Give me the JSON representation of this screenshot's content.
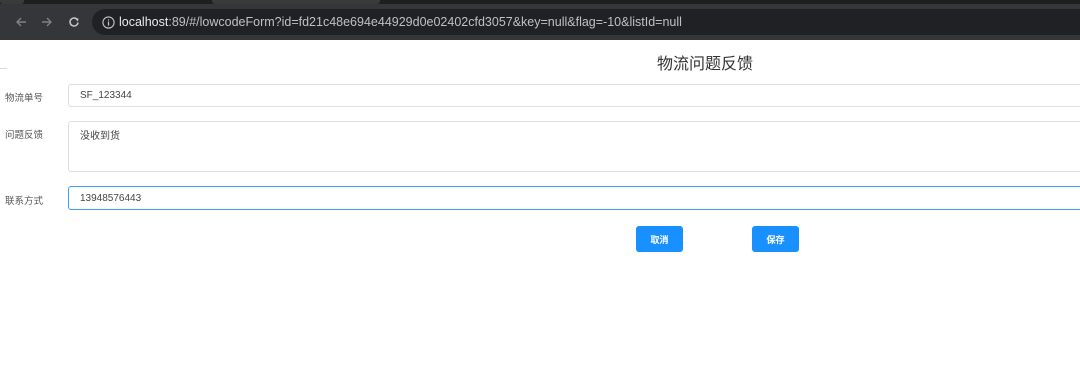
{
  "browser": {
    "url_host": "localhost",
    "url_rest": ":89/#/lowcodeForm?id=fd21c48e694e44929d0e02402cfd3057&key=null&flag=-10&listId=null"
  },
  "form": {
    "title": "物流问题反馈",
    "fields": [
      {
        "label": "物流单号",
        "value": "SF_123344"
      },
      {
        "label": "问题反馈",
        "value": "没收到货"
      },
      {
        "label": "联系方式",
        "value": "13948576443"
      }
    ],
    "cancel_label": "取消",
    "save_label": "保存"
  },
  "colors": {
    "primary": "#1890ff",
    "focus_border": "#409eff",
    "input_border": "#dcdfe6",
    "chrome_toolbar": "#35363a",
    "omnibox": "#202124"
  }
}
